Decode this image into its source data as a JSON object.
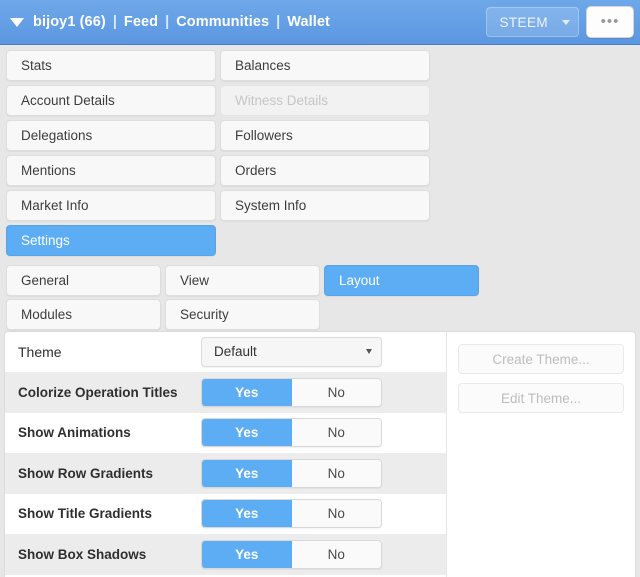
{
  "header": {
    "caret_icon": "caret-down-icon",
    "account": "bijoy1 (66)",
    "sep1": "|",
    "feed": "Feed",
    "sep2": "|",
    "communities": "Communities",
    "sep3": "|",
    "wallet": "Wallet",
    "chain_selected": "STEEM",
    "chain_caret_icon": "chevron-down-icon",
    "overflow_label": "•••",
    "accent_color": "#5dadf5",
    "bar_color": "#65a0e6"
  },
  "tabs": [
    {
      "label": "Stats",
      "state": "normal"
    },
    {
      "label": "Balances",
      "state": "normal"
    },
    {
      "label": "Account Details",
      "state": "normal"
    },
    {
      "label": "Witness Details",
      "state": "disabled"
    },
    {
      "label": "Delegations",
      "state": "normal"
    },
    {
      "label": "Followers",
      "state": "normal"
    },
    {
      "label": "Mentions",
      "state": "normal"
    },
    {
      "label": "Orders",
      "state": "normal"
    },
    {
      "label": "Market Info",
      "state": "normal"
    },
    {
      "label": "System Info",
      "state": "normal"
    },
    {
      "label": "Settings",
      "state": "active"
    },
    {
      "label": "",
      "state": "empty"
    }
  ],
  "subtabs": [
    {
      "label": "General",
      "state": "normal"
    },
    {
      "label": "View",
      "state": "normal"
    },
    {
      "label": "Layout",
      "state": "active"
    },
    {
      "label": "Modules",
      "state": "normal"
    },
    {
      "label": "Security",
      "state": "normal"
    },
    {
      "label": "",
      "state": "empty"
    },
    {
      "label": "",
      "state": "empty"
    },
    {
      "label": "",
      "state": "empty"
    }
  ],
  "settings": {
    "theme_row": {
      "label": "Theme",
      "value": "Default",
      "caret_icon": "chevron-down-icon"
    },
    "toggle_rows": [
      {
        "label": "Colorize Operation Titles",
        "yes": "Yes",
        "no": "No",
        "selected": "Yes"
      },
      {
        "label": "Show Animations",
        "yes": "Yes",
        "no": "No",
        "selected": "Yes"
      },
      {
        "label": "Show Row Gradients",
        "yes": "Yes",
        "no": "No",
        "selected": "Yes"
      },
      {
        "label": "Show Title Gradients",
        "yes": "Yes",
        "no": "No",
        "selected": "Yes"
      },
      {
        "label": "Show Box Shadows",
        "yes": "Yes",
        "no": "No",
        "selected": "Yes"
      }
    ]
  },
  "actions": {
    "create_theme": "Create Theme...",
    "edit_theme": "Edit Theme..."
  }
}
